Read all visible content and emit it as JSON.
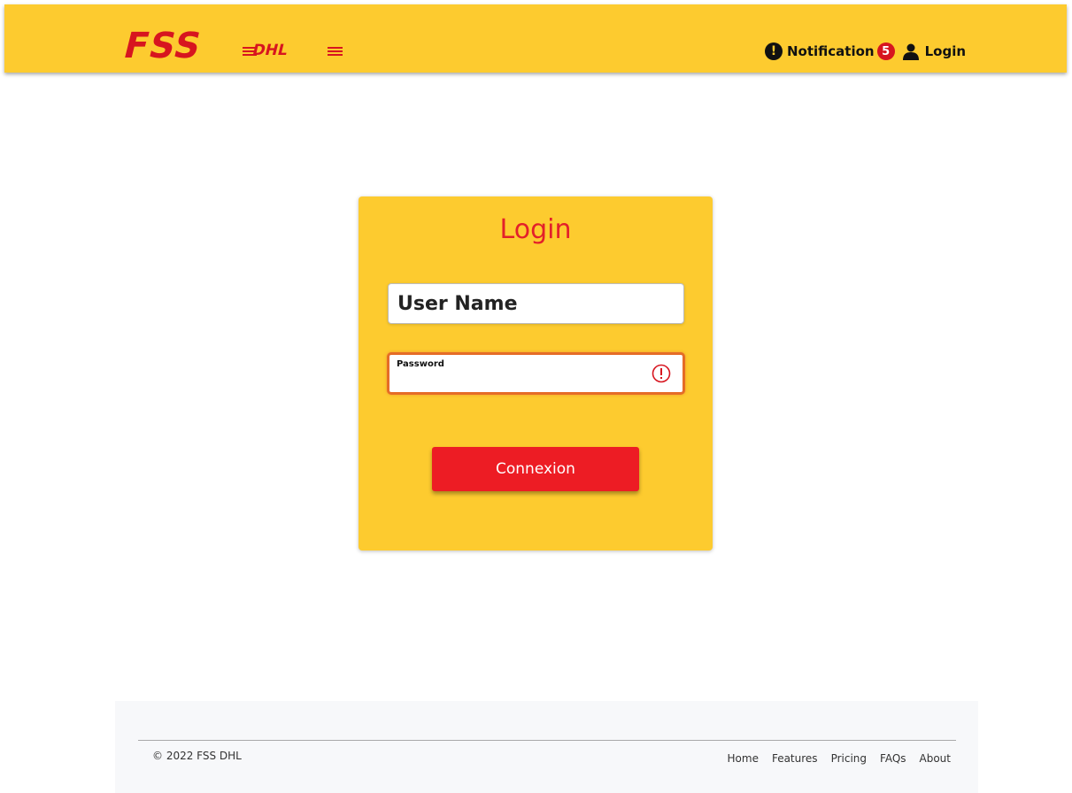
{
  "brand": {
    "logo_text": "FSS",
    "logo_subtext": "DHL",
    "primary_color": "#fdcb2f",
    "accent_color": "#d7151f"
  },
  "navbar": {
    "notification_icon": "exclamation-circle-icon",
    "notification_label": "Notification",
    "notification_count": "5",
    "login_icon": "user-icon",
    "login_label": "Login"
  },
  "login_form": {
    "title": "Login",
    "username_value": "User Name",
    "password_label": "Password",
    "password_value": "",
    "password_error_icon": "error-circle-icon",
    "submit_label": "Connexion"
  },
  "footer": {
    "copyright": "© 2022 FSS DHL",
    "links": [
      "Home",
      "Features",
      "Pricing",
      "FAQs",
      "About"
    ]
  }
}
